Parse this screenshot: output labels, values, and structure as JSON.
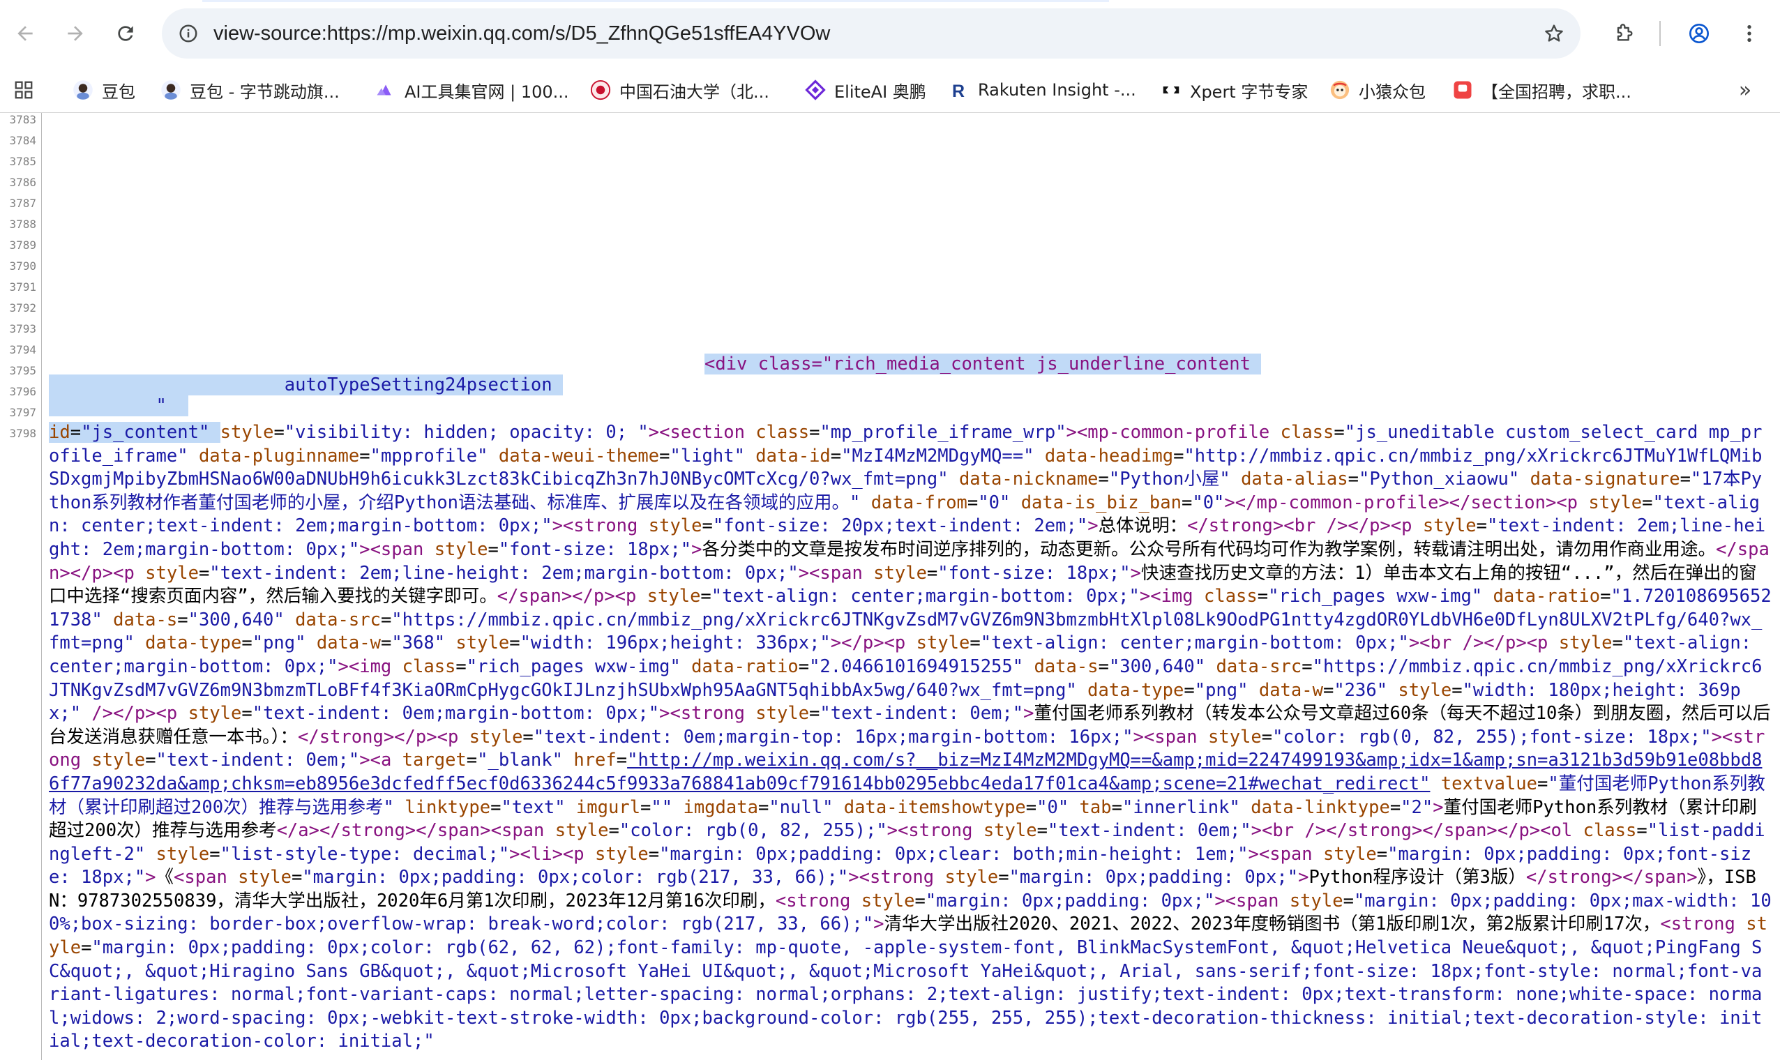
{
  "browser": {
    "url": "view-source:https://mp.weixin.qq.com/s/D5_ZfhnQGe51sffEA4YVOw",
    "icons": {
      "back": "arrow-left-icon",
      "forward": "arrow-right-icon",
      "reload": "reload-icon",
      "site_info": "info-icon",
      "bookmark": "star-icon",
      "extensions": "puzzle-icon",
      "profile": "account-icon",
      "menu": "more-vert-icon"
    }
  },
  "bookmarks": [
    {
      "label": "豆包",
      "icon": "doubao-icon"
    },
    {
      "label": "豆包 - 字节跳动旗...",
      "icon": "doubao-icon"
    },
    {
      "label": "AI工具集官网 | 100...",
      "icon": "ai-tools-icon"
    },
    {
      "label": "中国石油大学（北...",
      "icon": "cup-logo-icon"
    },
    {
      "label": "EliteAI 奥鹏",
      "icon": "eliteai-icon"
    },
    {
      "label": "Rakuten Insight -...",
      "icon": "rakuten-icon"
    },
    {
      "label": "Xpert 字节专家",
      "icon": "xpert-icon"
    },
    {
      "label": "小猿众包",
      "icon": "xiaoyuan-icon"
    },
    {
      "label": "【全国招聘，求职...",
      "icon": "recruit-icon"
    }
  ],
  "colors": {
    "tag": "#881280",
    "attr_name": "#994500",
    "attr_value": "#1a1aa6",
    "selection": "#c1daf7",
    "line_number": "#808080"
  },
  "source": {
    "line_numbers": [
      "3783",
      "3784",
      "3785",
      "3786",
      "3787",
      "3788",
      "3789",
      "3790",
      "3791",
      "3792",
      "3793",
      "3794",
      "3795",
      "3796",
      "3797",
      "3798"
    ],
    "line_3795": "<div class=\"rich_media_content js_underline_content",
    "line_3796": "autoTypeSetting24psection",
    "line_3797": "\"",
    "line_3798_attr": "id",
    "line_3798_val": "\"js_content\"",
    "tokens": [
      [
        "an",
        " style"
      ],
      [
        "tx",
        "="
      ],
      [
        "av",
        "\"visibility: hidden; opacity: 0; \""
      ],
      [
        "t",
        ">"
      ],
      [
        "t",
        "<section "
      ],
      [
        "an",
        "class"
      ],
      [
        "tx",
        "="
      ],
      [
        "av",
        "\"mp_profile_iframe_wrp\""
      ],
      [
        "t",
        ">"
      ],
      [
        "t",
        "<mp-common-profile "
      ],
      [
        "an",
        "class"
      ],
      [
        "tx",
        "="
      ],
      [
        "av",
        "\"js_uneditable custom_select_card mp_profile_iframe\""
      ],
      [
        "an",
        " data-pluginname"
      ],
      [
        "tx",
        "="
      ],
      [
        "av",
        "\"mpprofile\""
      ],
      [
        "an",
        " data-weui-theme"
      ],
      [
        "tx",
        "="
      ],
      [
        "av",
        "\"light\""
      ],
      [
        "an",
        " data-id"
      ],
      [
        "tx",
        "="
      ],
      [
        "av",
        "\"MzI4MzM2MDgyMQ==\""
      ],
      [
        "an",
        " data-headimg"
      ],
      [
        "tx",
        "="
      ],
      [
        "av",
        "\"http://mmbiz.qpic.cn/mmbiz_png/xXrickrc6JTMuY1WfLQMibSDxgmjMpibyZbmHSNao6W00aDNUbH9h6icukk3Lzct83kCibicqZh3n7hJ0NBycOMTcXcg/0?wx_fmt=png\""
      ],
      [
        "an",
        " data-nickname"
      ],
      [
        "tx",
        "="
      ],
      [
        "av",
        "\"Python小屋\""
      ],
      [
        "an",
        " data-alias"
      ],
      [
        "tx",
        "="
      ],
      [
        "av",
        "\"Python_xiaowu\""
      ],
      [
        "an",
        " data-signature"
      ],
      [
        "tx",
        "="
      ],
      [
        "av",
        "\"17本Python系列教材作者董付国老师的小屋，介绍Python语法基础、标准库、扩展库以及在各领域的应用。\""
      ],
      [
        "an",
        " data-from"
      ],
      [
        "tx",
        "="
      ],
      [
        "av",
        "\"0\""
      ],
      [
        "an",
        " data-is_biz_ban"
      ],
      [
        "tx",
        "="
      ],
      [
        "av",
        "\"0\""
      ],
      [
        "t",
        "></mp-common-profile></section><p "
      ],
      [
        "an",
        "style"
      ],
      [
        "tx",
        "="
      ],
      [
        "av",
        "\"text-align: center;text-indent: 2em;margin-bottom: 0px;\""
      ],
      [
        "t",
        "><strong "
      ],
      [
        "an",
        "style"
      ],
      [
        "tx",
        "="
      ],
      [
        "av",
        "\"font-size: 20px;text-indent: 2em;\""
      ],
      [
        "t",
        ">"
      ],
      [
        "tx",
        "总体说明："
      ],
      [
        "t",
        "</strong><br  /></p><p "
      ],
      [
        "an",
        "style"
      ],
      [
        "tx",
        "="
      ],
      [
        "av",
        "\"text-indent: 2em;line-height: 2em;margin-bottom: 0px;\""
      ],
      [
        "t",
        "><span "
      ],
      [
        "an",
        "style"
      ],
      [
        "tx",
        "="
      ],
      [
        "av",
        "\"font-size: 18px;\""
      ],
      [
        "t",
        ">"
      ],
      [
        "tx",
        "各分类中的文章是按发布时间逆序排列的，动态更新。公众号所有代码均可作为教学案例，转载请注明出处，请勿用作商业用途。"
      ],
      [
        "t",
        "</span></p><p "
      ],
      [
        "an",
        "style"
      ],
      [
        "tx",
        "="
      ],
      [
        "av",
        "\"text-indent: 2em;line-height: 2em;margin-bottom: 0px;\""
      ],
      [
        "t",
        "><span "
      ],
      [
        "an",
        "style"
      ],
      [
        "tx",
        "="
      ],
      [
        "av",
        "\"font-size: 18px;\""
      ],
      [
        "t",
        ">"
      ],
      [
        "tx",
        "快速查找历史文章的方法：1）单击本文右上角的按钮“...”，然后在弹出的窗口中选择“搜索页面内容”，然后输入要找的关键字即可。"
      ],
      [
        "t",
        "</span></p><p "
      ],
      [
        "an",
        "style"
      ],
      [
        "tx",
        "="
      ],
      [
        "av",
        "\"text-align: center;margin-bottom: 0px;\""
      ],
      [
        "t",
        "><img "
      ],
      [
        "an",
        "class"
      ],
      [
        "tx",
        "="
      ],
      [
        "av",
        "\"rich_pages wxw-img\""
      ],
      [
        "an",
        " data-ratio"
      ],
      [
        "tx",
        "="
      ],
      [
        "av",
        "\"1.7201086956521738\""
      ],
      [
        "an",
        " data-s"
      ],
      [
        "tx",
        "="
      ],
      [
        "av",
        "\"300,640\""
      ],
      [
        "an",
        " data-src"
      ],
      [
        "tx",
        "="
      ],
      [
        "av",
        "\"https://mmbiz.qpic.cn/mmbiz_png/xXrickrc6JTNKgvZsdM7vGVZ6m9N3bmzmbHtXlpl08Lk9OodPG1ntty4zgdOR0YLdbVH6e0DfLyn8ULXV2tPLfg/640?wx_fmt=png\""
      ],
      [
        "an",
        " data-type"
      ],
      [
        "tx",
        "="
      ],
      [
        "av",
        "\"png\""
      ],
      [
        "an",
        " data-w"
      ],
      [
        "tx",
        "="
      ],
      [
        "av",
        "\"368\""
      ],
      [
        "an",
        " style"
      ],
      [
        "tx",
        "="
      ],
      [
        "av",
        "\"width: 196px;height: 336px;\""
      ],
      [
        "t",
        "></p><p "
      ],
      [
        "an",
        "style"
      ],
      [
        "tx",
        "="
      ],
      [
        "av",
        "\"text-align: center;margin-bottom: 0px;\""
      ],
      [
        "t",
        "><br  /></p><p "
      ],
      [
        "an",
        "style"
      ],
      [
        "tx",
        "="
      ],
      [
        "av",
        "\"text-align: center;margin-bottom: 0px;\""
      ],
      [
        "t",
        "><img "
      ],
      [
        "an",
        "class"
      ],
      [
        "tx",
        "="
      ],
      [
        "av",
        "\"rich_pages wxw-img\""
      ],
      [
        "an",
        " data-ratio"
      ],
      [
        "tx",
        "="
      ],
      [
        "av",
        "\"2.0466101694915255\""
      ],
      [
        "an",
        " data-s"
      ],
      [
        "tx",
        "="
      ],
      [
        "av",
        "\"300,640\""
      ],
      [
        "an",
        " data-src"
      ],
      [
        "tx",
        "="
      ],
      [
        "av",
        "\"https://mmbiz.qpic.cn/mmbiz_png/xXrickrc6JTNKgvZsdM7vGVZ6m9N3bmzmTLoBFf4f3KiaORmCpHygcGOkIJLnzjhSUbxWph95AaGNT5qhibbAx5wg/640?wx_fmt=png\""
      ],
      [
        "an",
        " data-type"
      ],
      [
        "tx",
        "="
      ],
      [
        "av",
        "\"png\""
      ],
      [
        "an",
        " data-w"
      ],
      [
        "tx",
        "="
      ],
      [
        "av",
        "\"236\""
      ],
      [
        "an",
        " style"
      ],
      [
        "tx",
        "="
      ],
      [
        "av",
        "\"width: 180px;height: 369px;\""
      ],
      [
        "t",
        "  /></p><p "
      ],
      [
        "an",
        "style"
      ],
      [
        "tx",
        "="
      ],
      [
        "av",
        "\"text-indent: 0em;margin-bottom: 0px;\""
      ],
      [
        "t",
        "><strong "
      ],
      [
        "an",
        "style"
      ],
      [
        "tx",
        "="
      ],
      [
        "av",
        "\"text-indent: 0em;\""
      ],
      [
        "t",
        ">"
      ],
      [
        "tx",
        "董付国老师系列教材（转发本公众号文章超过60条（每天不超过10条）到朋友圈，然后可以后台发送消息获赠任意一本书。）："
      ],
      [
        "t",
        "</strong></p><p "
      ],
      [
        "an",
        "style"
      ],
      [
        "tx",
        "="
      ],
      [
        "av",
        "\"text-indent: 0em;margin-top: 16px;margin-bottom: 16px;\""
      ],
      [
        "t",
        "><span "
      ],
      [
        "an",
        "style"
      ],
      [
        "tx",
        "="
      ],
      [
        "av",
        "\"color: rgb(0, 82, 255);font-size: 18px;\""
      ],
      [
        "t",
        "><strong "
      ],
      [
        "an",
        "style"
      ],
      [
        "tx",
        "="
      ],
      [
        "av",
        "\"text-indent: 0em;\""
      ],
      [
        "t",
        "><a "
      ],
      [
        "an",
        "target"
      ],
      [
        "tx",
        "="
      ],
      [
        "av",
        "\"_blank\""
      ],
      [
        "an",
        " href"
      ],
      [
        "tx",
        "="
      ],
      [
        "lk",
        "\"http://mp.weixin.qq.com/s?__biz=MzI4MzM2MDgyMQ==&amp;mid=2247499193&amp;idx=1&amp;sn=a3121b3d59b91e08bbd86f77a90232da&amp;chksm=eb8956e3dcfedff5ecf0d6336244c5f9933a768841ab09cf791614bb0295ebbc4eda17f01ca4&amp;scene=21#wechat_redirect\""
      ],
      [
        "an",
        " textvalue"
      ],
      [
        "tx",
        "="
      ],
      [
        "av",
        "\"董付国老师Python系列教材（累计印刷超过200次）推荐与选用参考\""
      ],
      [
        "an",
        " linktype"
      ],
      [
        "tx",
        "="
      ],
      [
        "av",
        "\"text\""
      ],
      [
        "an",
        " imgurl"
      ],
      [
        "tx",
        "="
      ],
      [
        "av",
        "\"\""
      ],
      [
        "an",
        " imgdata"
      ],
      [
        "tx",
        "="
      ],
      [
        "av",
        "\"null\""
      ],
      [
        "an",
        " data-itemshowtype"
      ],
      [
        "tx",
        "="
      ],
      [
        "av",
        "\"0\""
      ],
      [
        "an",
        " tab"
      ],
      [
        "tx",
        "="
      ],
      [
        "av",
        "\"innerlink\""
      ],
      [
        "an",
        " data-linktype"
      ],
      [
        "tx",
        "="
      ],
      [
        "av",
        "\"2\""
      ],
      [
        "t",
        ">"
      ],
      [
        "tx",
        "董付国老师Python系列教材（累计印刷超过200次）推荐与选用参考"
      ],
      [
        "t",
        "</a></strong></span><span "
      ],
      [
        "an",
        "style"
      ],
      [
        "tx",
        "="
      ],
      [
        "av",
        "\"color: rgb(0, 82, 255);\""
      ],
      [
        "t",
        "><strong "
      ],
      [
        "an",
        "style"
      ],
      [
        "tx",
        "="
      ],
      [
        "av",
        "\"text-indent: 0em;\""
      ],
      [
        "t",
        "><br  /></strong></span></p><ol "
      ],
      [
        "an",
        "class"
      ],
      [
        "tx",
        "="
      ],
      [
        "av",
        "\"list-paddingleft-2\""
      ],
      [
        "an",
        " style"
      ],
      [
        "tx",
        "="
      ],
      [
        "av",
        "\"list-style-type: decimal;\""
      ],
      [
        "t",
        "><li><p "
      ],
      [
        "an",
        "style"
      ],
      [
        "tx",
        "="
      ],
      [
        "av",
        "\"margin: 0px;padding: 0px;clear: both;min-height: 1em;\""
      ],
      [
        "t",
        "><span "
      ],
      [
        "an",
        "style"
      ],
      [
        "tx",
        "="
      ],
      [
        "av",
        "\"margin: 0px;padding: 0px;font-size: 18px;\""
      ],
      [
        "t",
        ">"
      ],
      [
        "tx",
        "《"
      ],
      [
        "t",
        "<span "
      ],
      [
        "an",
        "style"
      ],
      [
        "tx",
        "="
      ],
      [
        "av",
        "\"margin: 0px;padding: 0px;color: rgb(217, 33, 66);\""
      ],
      [
        "t",
        "><strong "
      ],
      [
        "an",
        "style"
      ],
      [
        "tx",
        "="
      ],
      [
        "av",
        "\"margin: 0px;padding: 0px;\""
      ],
      [
        "t",
        ">"
      ],
      [
        "tx",
        "Python程序设计（第3版）"
      ],
      [
        "t",
        "</strong></span>"
      ],
      [
        "tx",
        "》，ISBN：9787302550839，清华大学出版社，2020年6月第1次印刷，2023年12月第16次印刷，"
      ],
      [
        "t",
        "<strong "
      ],
      [
        "an",
        "style"
      ],
      [
        "tx",
        "="
      ],
      [
        "av",
        "\"margin: 0px;padding: 0px;\""
      ],
      [
        "t",
        "><span "
      ],
      [
        "an",
        "style"
      ],
      [
        "tx",
        "="
      ],
      [
        "av",
        "\"margin: 0px;padding: 0px;max-width: 100%;box-sizing: border-box;overflow-wrap: break-word;color: rgb(217, 33, 66);\""
      ],
      [
        "t",
        ">"
      ],
      [
        "tx",
        "清华大学出版社2020、2021、2022、2023年度畅销图书（第1版印刷1次，第2版累计印刷17次，"
      ],
      [
        "t",
        "<strong "
      ],
      [
        "an",
        "style"
      ],
      [
        "tx",
        "="
      ],
      [
        "av",
        "\"margin: 0px;padding: 0px;color: rgb(62, 62, 62);font-family: mp-quote, -apple-system-font, BlinkMacSystemFont, &quot;Helvetica Neue&quot;, &quot;PingFang SC&quot;, &quot;Hiragino Sans GB&quot;, &quot;Microsoft YaHei UI&quot;, &quot;Microsoft YaHei&quot;, Arial, sans-serif;font-size: 18px;font-style: normal;font-variant-ligatures: normal;font-variant-caps: normal;letter-spacing: normal;orphans: 2;text-align: justify;text-indent: 0px;text-transform: none;white-space: normal;widows: 2;word-spacing: 0px;-webkit-text-stroke-width: 0px;background-color: rgb(255, 255, 255);text-decoration-thickness: initial;text-decoration-style: initial;text-decoration-color: initial;\""
      ]
    ]
  }
}
